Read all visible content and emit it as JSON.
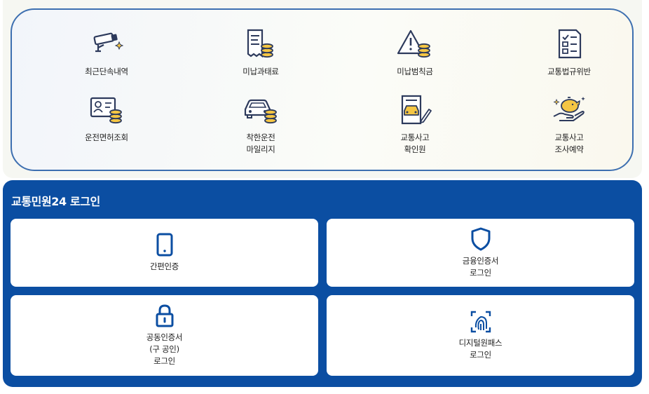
{
  "services": [
    {
      "id": "recent-enforcement",
      "label": "최근단속내역",
      "icon": "cctv-camera-icon"
    },
    {
      "id": "unpaid-fines",
      "label": "미납과태료",
      "icon": "receipt-coins-icon"
    },
    {
      "id": "unpaid-penalty",
      "label": "미납범칙금",
      "icon": "warning-coins-icon"
    },
    {
      "id": "traffic-violation",
      "label": "교통법규위반",
      "icon": "checklist-document-icon"
    },
    {
      "id": "license-check",
      "label": "운전면허조회",
      "icon": "id-card-coins-icon"
    },
    {
      "id": "safe-driving-mileage",
      "label": "착한운전\n마일리지",
      "icon": "car-coins-icon"
    },
    {
      "id": "accident-confirmation",
      "label": "교통사고\n확인원",
      "icon": "car-document-icon"
    },
    {
      "id": "accident-investigation-booking",
      "label": "교통사고\n조사예약",
      "icon": "hand-piggybank-icon"
    }
  ],
  "login": {
    "title": "교통민원24 로그인",
    "options": [
      {
        "id": "simple-auth",
        "label": "간편인증",
        "icon": "smartphone-icon"
      },
      {
        "id": "financial-cert",
        "label": "금융인증서\n로그인",
        "icon": "shield-icon"
      },
      {
        "id": "joint-cert",
        "label": "공동인증서\n(구 공인)\n로그인",
        "icon": "lock-icon"
      },
      {
        "id": "digital-onepass",
        "label": "디지털원패스\n로그인",
        "icon": "fingerprint-icon"
      }
    ]
  },
  "colors": {
    "primary": "#0b4ea2",
    "border": "#3d6fb0",
    "icon_stroke": "#2d3a5c",
    "coin": "#f5c644"
  }
}
